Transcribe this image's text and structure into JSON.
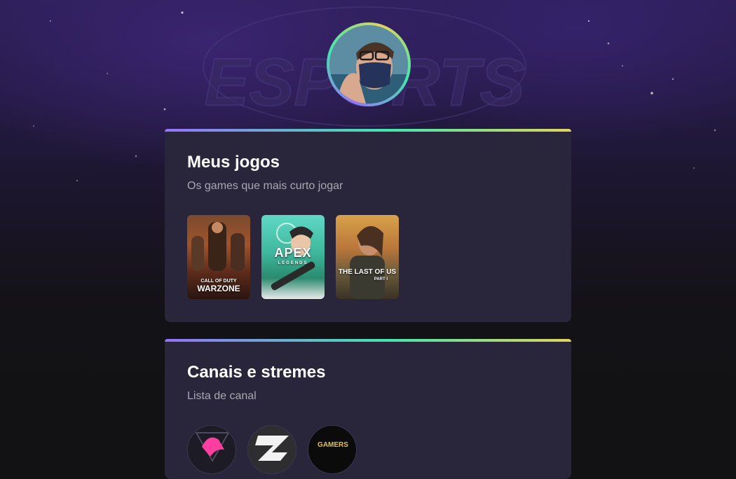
{
  "profile": {
    "avatar_alt": "Foto de perfil"
  },
  "background": {
    "logo_text": "ESPORTS"
  },
  "games_card": {
    "title": "Meus jogos",
    "subtitle": "Os games que mais curto jogar",
    "games": [
      {
        "name": "CALL OF DUTY WARZONE",
        "top": "CALL OF DUTY",
        "bottom": "WARZONE"
      },
      {
        "name": "APEX LEGENDS",
        "top": "APEX",
        "bottom": "LEGENDS"
      },
      {
        "name": "THE LAST OF US PART I",
        "top": "THE LAST OF US",
        "bottom": "PART I"
      }
    ]
  },
  "channels_card": {
    "title": "Canais e stremes",
    "subtitle": "Lista de canal",
    "channels": [
      {
        "icon": "pink-horse-logo-icon"
      },
      {
        "icon": "z-letter-logo-icon"
      },
      {
        "icon": "gamers-logo-icon",
        "label": "GAMERS"
      }
    ]
  },
  "colors": {
    "accent_purple": "#9572fc",
    "accent_green": "#43e7ad",
    "accent_yellow": "#e2d45c",
    "card_bg": "#29253a"
  }
}
